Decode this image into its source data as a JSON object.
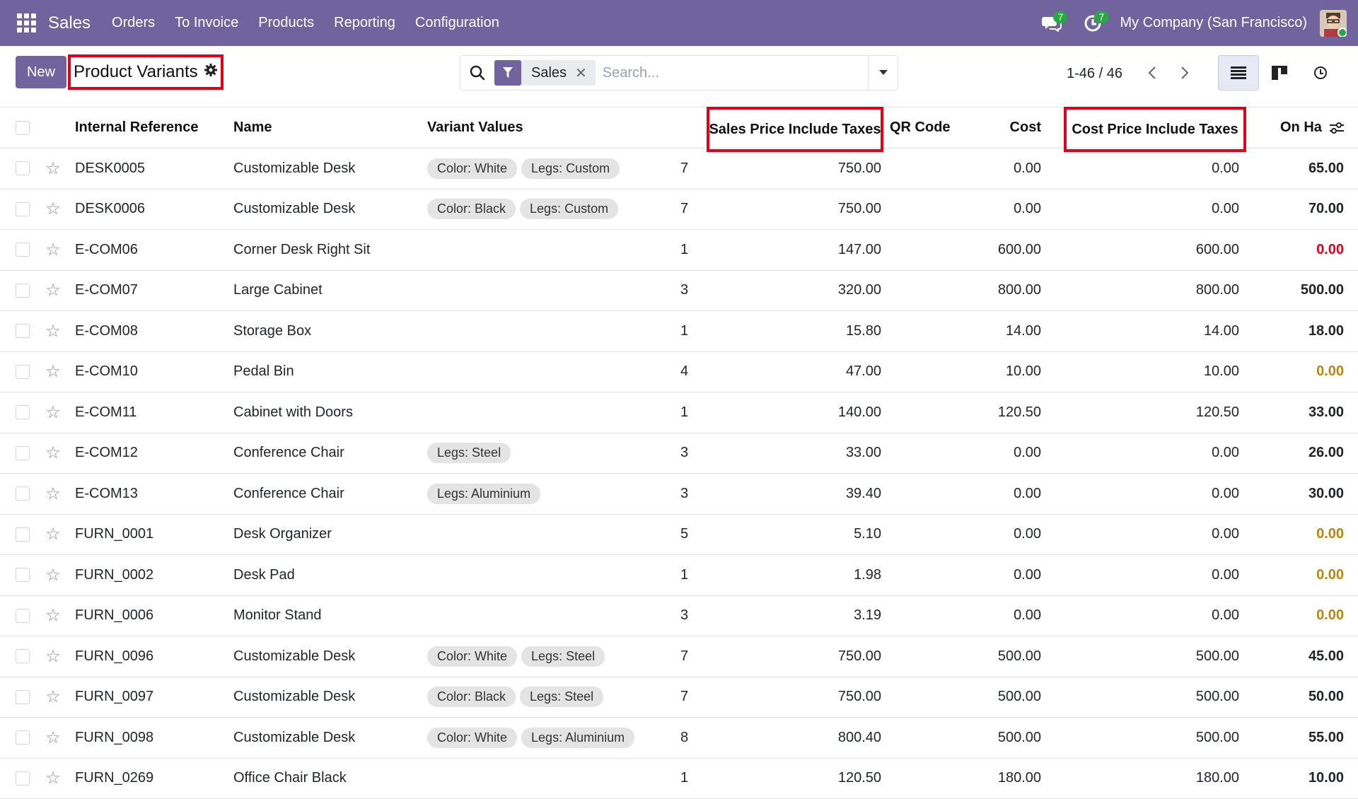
{
  "nav": {
    "app": "Sales",
    "menu": [
      "Orders",
      "To Invoice",
      "Products",
      "Reporting",
      "Configuration"
    ],
    "messages_count": "7",
    "activities_count": "7",
    "company": "My Company (San Francisco)"
  },
  "control": {
    "new_label": "New",
    "title": "Product Variants",
    "facet_label": "Sales",
    "search_placeholder": "Search...",
    "pager": "1-46 / 46"
  },
  "columns": {
    "ref": "Internal Reference",
    "name": "Name",
    "variants": "Variant Values",
    "sales_price": "Sales Price Include Taxes",
    "qr": "QR Code",
    "cost": "Cost",
    "cost_taxes": "Cost Price Include Taxes",
    "on_hand": "On Ha"
  },
  "rows": [
    {
      "ref": "DESK0005",
      "name": "Customizable Desk",
      "tags": [
        "Color: White",
        "Legs: Custom"
      ],
      "qr": "7",
      "sales_price": "750.00",
      "cost": "0.00",
      "cost_taxes": "0.00",
      "on_hand": "65.00",
      "on_hand_state": "normal"
    },
    {
      "ref": "DESK0006",
      "name": "Customizable Desk",
      "tags": [
        "Color: Black",
        "Legs: Custom"
      ],
      "qr": "7",
      "sales_price": "750.00",
      "cost": "0.00",
      "cost_taxes": "0.00",
      "on_hand": "70.00",
      "on_hand_state": "normal"
    },
    {
      "ref": "E-COM06",
      "name": "Corner Desk Right Sit",
      "tags": [],
      "qr": "1",
      "sales_price": "147.00",
      "cost": "600.00",
      "cost_taxes": "600.00",
      "on_hand": "0.00",
      "on_hand_state": "negative"
    },
    {
      "ref": "E-COM07",
      "name": "Large Cabinet",
      "tags": [],
      "qr": "3",
      "sales_price": "320.00",
      "cost": "800.00",
      "cost_taxes": "800.00",
      "on_hand": "500.00",
      "on_hand_state": "normal"
    },
    {
      "ref": "E-COM08",
      "name": "Storage Box",
      "tags": [],
      "qr": "1",
      "sales_price": "15.80",
      "cost": "14.00",
      "cost_taxes": "14.00",
      "on_hand": "18.00",
      "on_hand_state": "normal"
    },
    {
      "ref": "E-COM10",
      "name": "Pedal Bin",
      "tags": [],
      "qr": "4",
      "sales_price": "47.00",
      "cost": "10.00",
      "cost_taxes": "10.00",
      "on_hand": "0.00",
      "on_hand_state": "warning"
    },
    {
      "ref": "E-COM11",
      "name": "Cabinet with Doors",
      "tags": [],
      "qr": "1",
      "sales_price": "140.00",
      "cost": "120.50",
      "cost_taxes": "120.50",
      "on_hand": "33.00",
      "on_hand_state": "normal"
    },
    {
      "ref": "E-COM12",
      "name": "Conference Chair",
      "tags": [
        "Legs: Steel"
      ],
      "qr": "3",
      "sales_price": "33.00",
      "cost": "0.00",
      "cost_taxes": "0.00",
      "on_hand": "26.00",
      "on_hand_state": "normal"
    },
    {
      "ref": "E-COM13",
      "name": "Conference Chair",
      "tags": [
        "Legs: Aluminium"
      ],
      "qr": "3",
      "sales_price": "39.40",
      "cost": "0.00",
      "cost_taxes": "0.00",
      "on_hand": "30.00",
      "on_hand_state": "normal"
    },
    {
      "ref": "FURN_0001",
      "name": "Desk Organizer",
      "tags": [],
      "qr": "5",
      "sales_price": "5.10",
      "cost": "0.00",
      "cost_taxes": "0.00",
      "on_hand": "0.00",
      "on_hand_state": "warning"
    },
    {
      "ref": "FURN_0002",
      "name": "Desk Pad",
      "tags": [],
      "qr": "1",
      "sales_price": "1.98",
      "cost": "0.00",
      "cost_taxes": "0.00",
      "on_hand": "0.00",
      "on_hand_state": "warning"
    },
    {
      "ref": "FURN_0006",
      "name": "Monitor Stand",
      "tags": [],
      "qr": "3",
      "sales_price": "3.19",
      "cost": "0.00",
      "cost_taxes": "0.00",
      "on_hand": "0.00",
      "on_hand_state": "warning"
    },
    {
      "ref": "FURN_0096",
      "name": "Customizable Desk",
      "tags": [
        "Color: White",
        "Legs: Steel"
      ],
      "qr": "7",
      "sales_price": "750.00",
      "cost": "500.00",
      "cost_taxes": "500.00",
      "on_hand": "45.00",
      "on_hand_state": "normal"
    },
    {
      "ref": "FURN_0097",
      "name": "Customizable Desk",
      "tags": [
        "Color: Black",
        "Legs: Steel"
      ],
      "qr": "7",
      "sales_price": "750.00",
      "cost": "500.00",
      "cost_taxes": "500.00",
      "on_hand": "50.00",
      "on_hand_state": "normal"
    },
    {
      "ref": "FURN_0098",
      "name": "Customizable Desk",
      "tags": [
        "Color: White",
        "Legs: Aluminium"
      ],
      "qr": "8",
      "sales_price": "800.40",
      "cost": "500.00",
      "cost_taxes": "500.00",
      "on_hand": "55.00",
      "on_hand_state": "normal"
    },
    {
      "ref": "FURN_0269",
      "name": "Office Chair Black",
      "tags": [],
      "qr": "1",
      "sales_price": "120.50",
      "cost": "180.00",
      "cost_taxes": "180.00",
      "on_hand": "10.00",
      "on_hand_state": "normal"
    }
  ],
  "colors": {
    "brand": "#71639e",
    "highlight": "#e3001b",
    "badge": "#28a745",
    "warning": "#b8860b"
  }
}
